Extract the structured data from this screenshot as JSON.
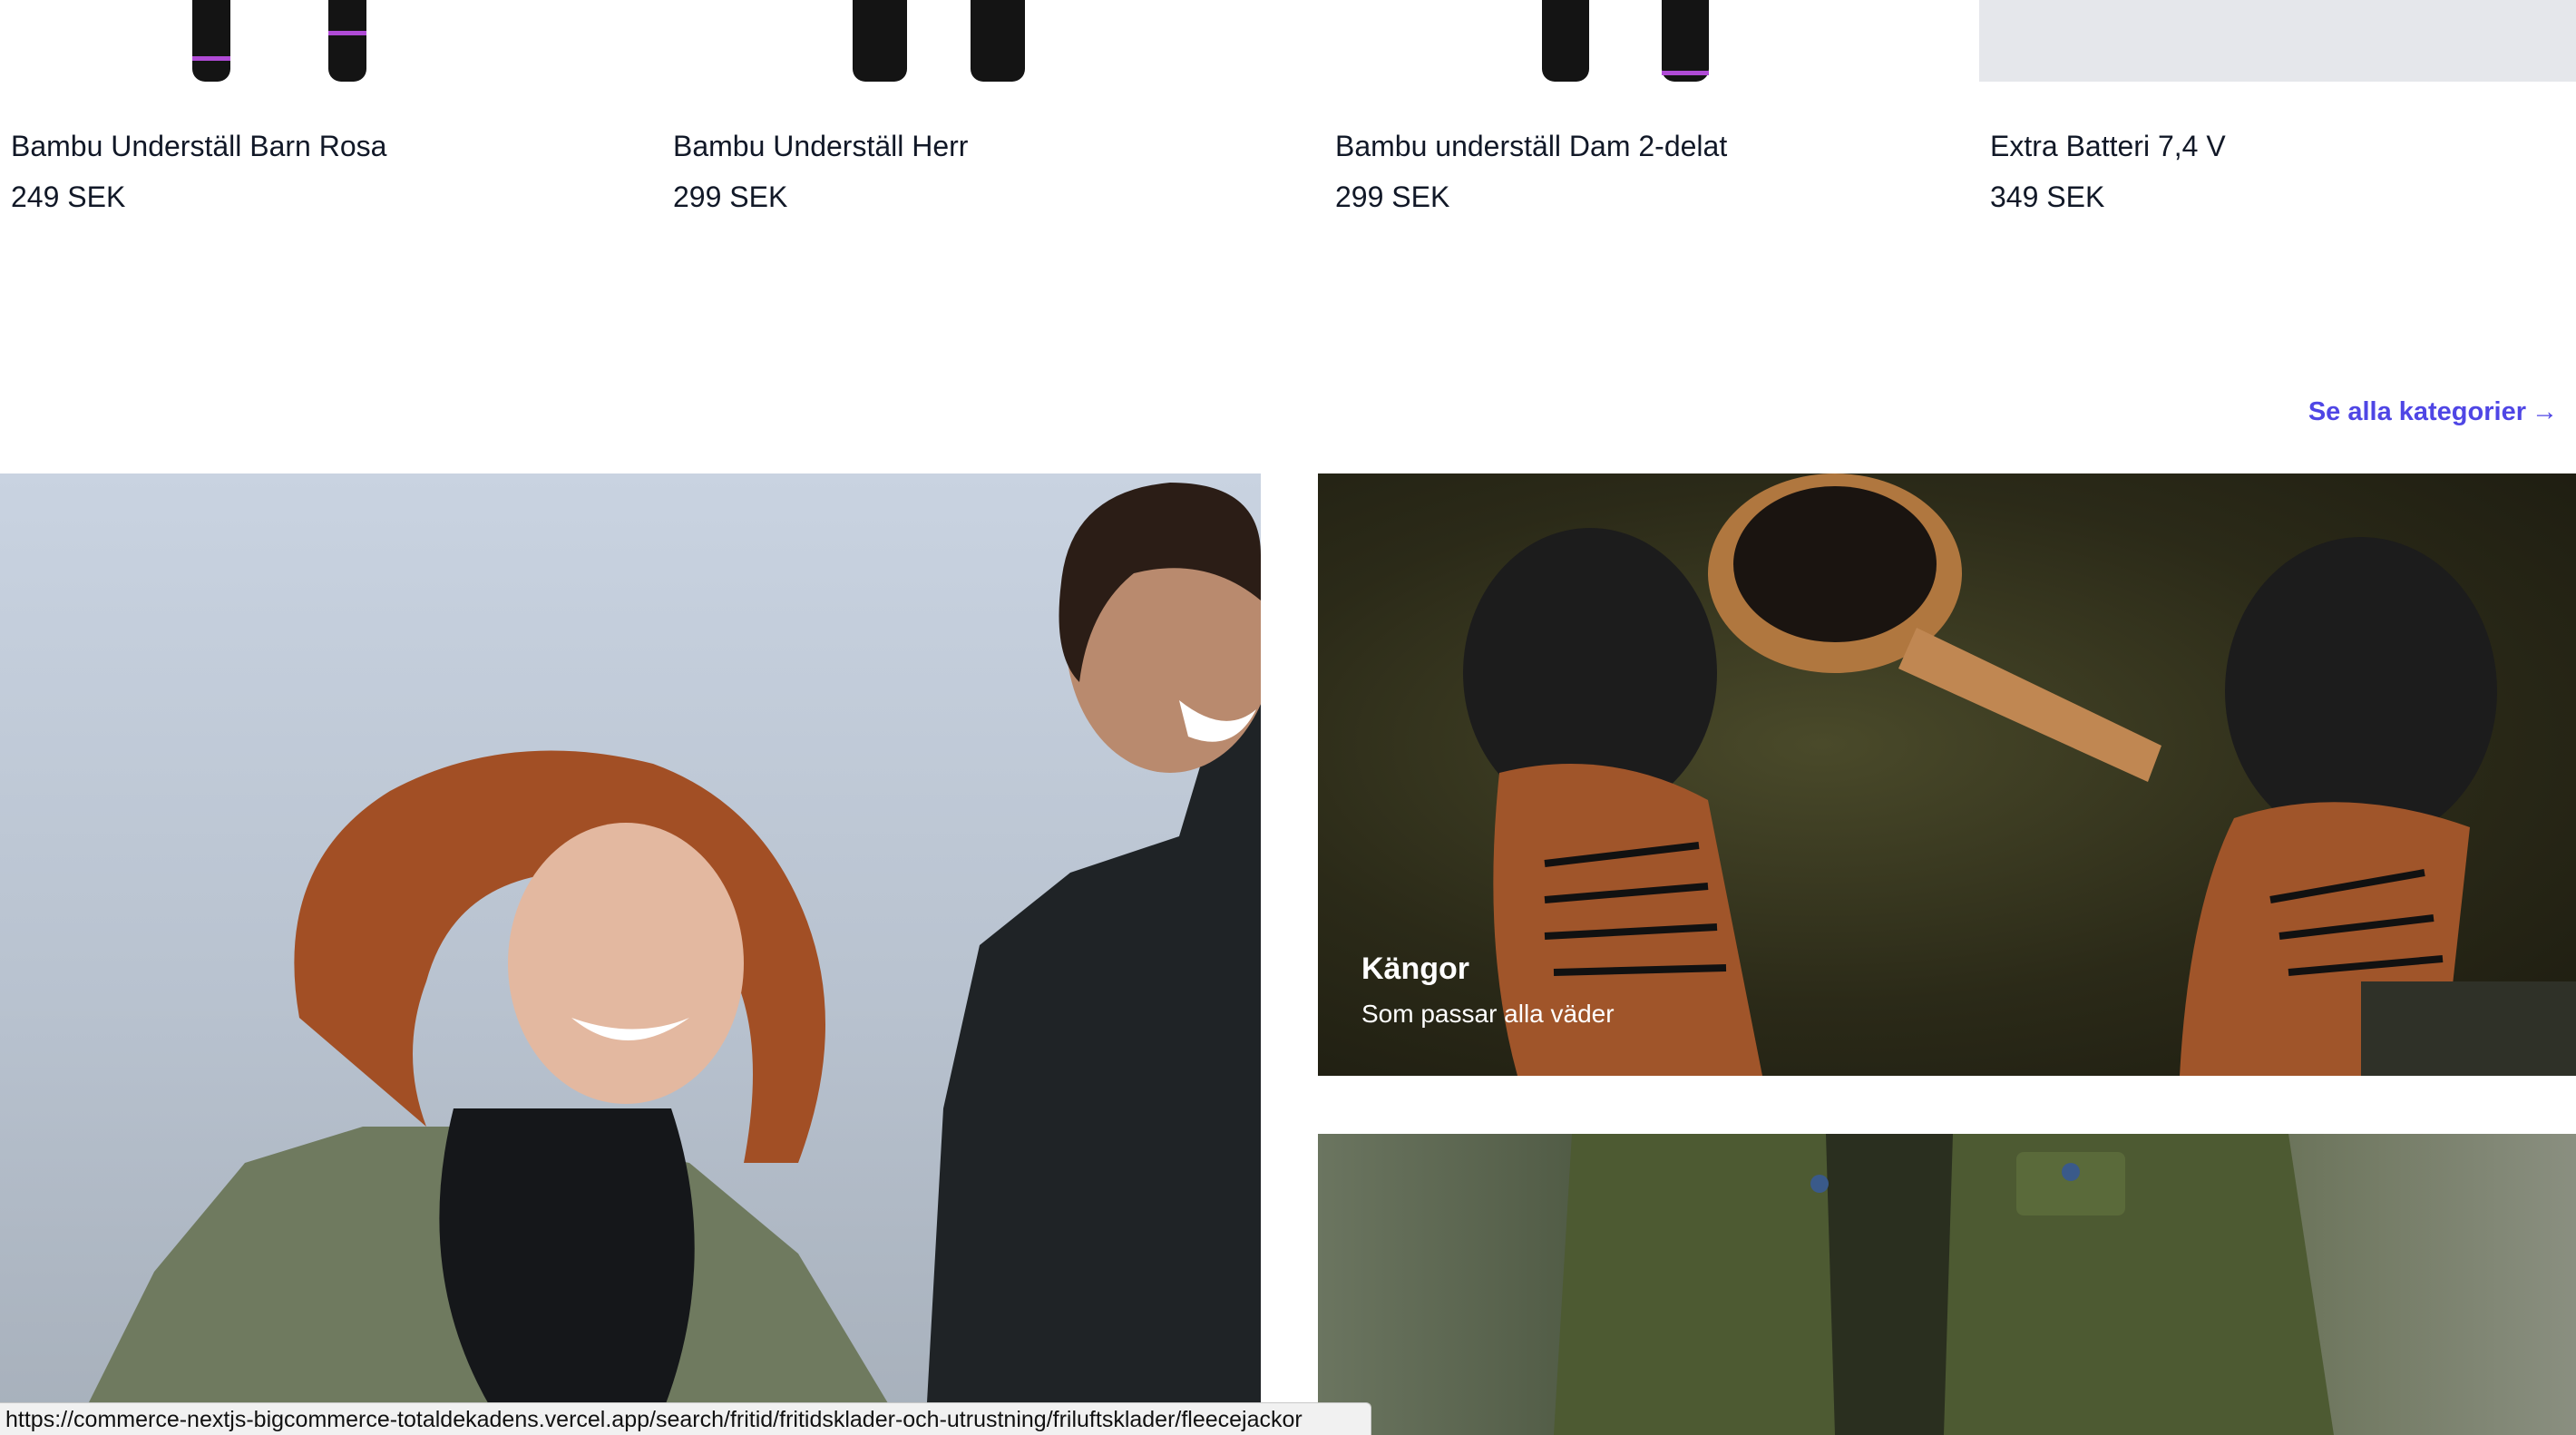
{
  "products": [
    {
      "title": "Bambu Underställ Barn Rosa",
      "price": "249 SEK",
      "thumb_color": "#141414",
      "cuff_color": "#b04bd6"
    },
    {
      "title": "Bambu Underställ Herr",
      "price": "299 SEK",
      "thumb_color": "#141414"
    },
    {
      "title": "Bambu underställ Dam 2-delat",
      "price": "299 SEK",
      "thumb_color": "#141414",
      "cuff_color": "#b04bd6"
    },
    {
      "title": "Extra Batteri 7,4 V",
      "price": "349 SEK",
      "thumb_color": "#e5e7eb"
    }
  ],
  "categories": {
    "see_all_label": "Se alla kategorier",
    "see_all_icon": "arrow-right-icon",
    "see_all_icon_glyph": "→",
    "accent_color": "#4f46e5",
    "tiles": [
      {
        "image": "people-in-outdoor-jackets-photo"
      },
      {
        "title": "Kängor",
        "subtitle": "Som passar alla väder",
        "image": "boots-on-moss-with-wooden-cup-photo"
      },
      {
        "image": "green-outdoor-pants-photo"
      }
    ]
  },
  "status_bar": {
    "url": "https://commerce-nextjs-bigcommerce-totaldekadens.vercel.app/search/fritid/fritidsklader-och-utrustning/friluftsklader/fleecejackor"
  }
}
